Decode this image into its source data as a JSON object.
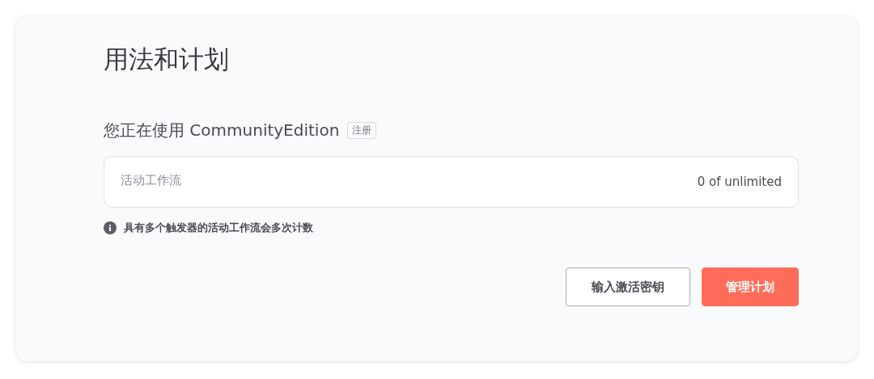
{
  "page": {
    "title": "用法和计划"
  },
  "plan": {
    "prefix": "您正在使用",
    "edition": "CommunityEdition",
    "tag": "注册"
  },
  "usage": {
    "label": "活动工作流",
    "value": "0 of unlimited"
  },
  "note": "具有多个触发器的活动工作流会多次计数",
  "buttons": [
    {
      "label": "输入激活密钥",
      "kind": "secondary"
    },
    {
      "label": "管理计划",
      "kind": "primary"
    }
  ]
}
